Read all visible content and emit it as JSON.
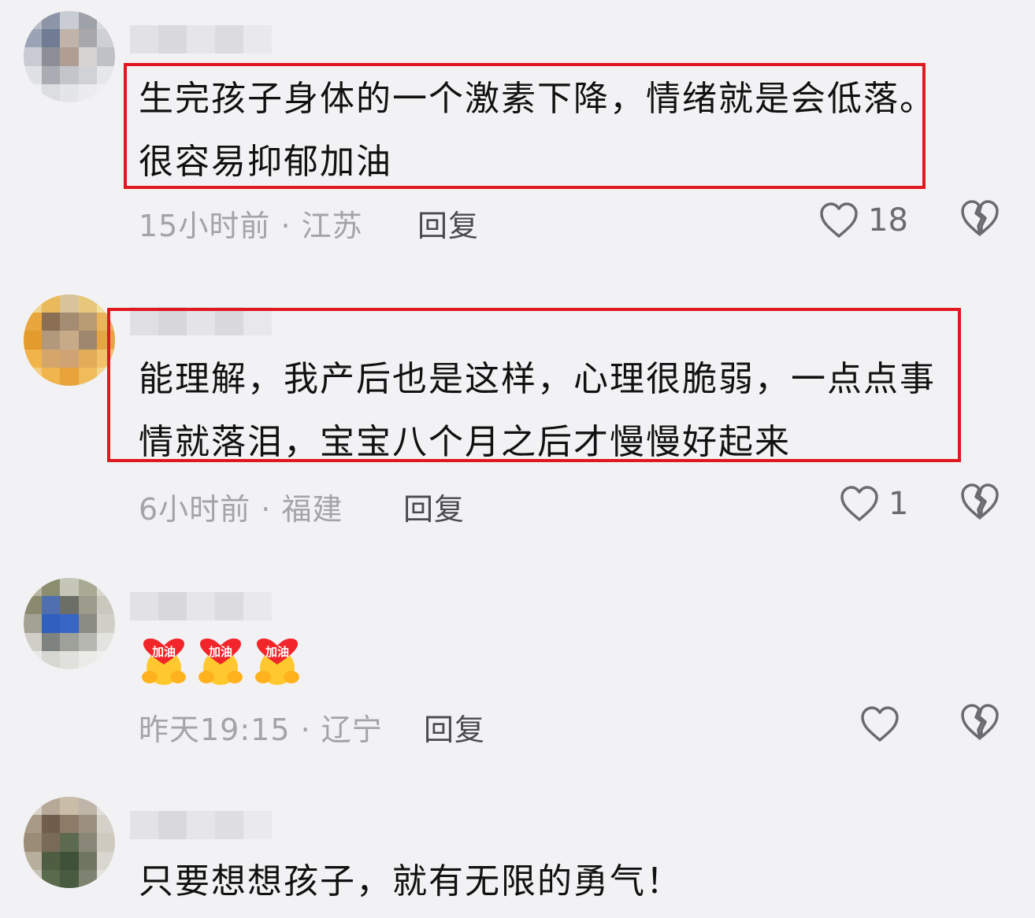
{
  "colors": {
    "background": "#f2f2f4",
    "highlight": "#e11820",
    "meta": "#a3a3a8",
    "text": "#111111"
  },
  "comments": [
    {
      "text_lines": [
        "生完孩子身体的一个激素下降，情绪就是会低落。",
        "很容易抑郁加油"
      ],
      "time": "15小时前",
      "sep": "·",
      "location": "江苏",
      "reply": "回复",
      "likes": "18"
    },
    {
      "text_lines": [
        "能理解，我产后也是这样，心理很脆弱，一点点事",
        "情就落泪，宝宝八个月之后才慢慢好起来"
      ],
      "time": "6小时前",
      "sep": "·",
      "location": "福建",
      "reply": "回复",
      "likes": "1"
    },
    {
      "emoji_text": [
        "加油",
        "加油",
        "加油"
      ],
      "time": "昨天19:15",
      "sep": "·",
      "location": "辽宁",
      "reply": "回复",
      "likes": ""
    },
    {
      "text_lines": [
        "只要想想孩子，就有无限的勇气！"
      ]
    }
  ],
  "icons": {
    "like": "heart-outline-icon",
    "dislike": "broken-heart-icon"
  }
}
